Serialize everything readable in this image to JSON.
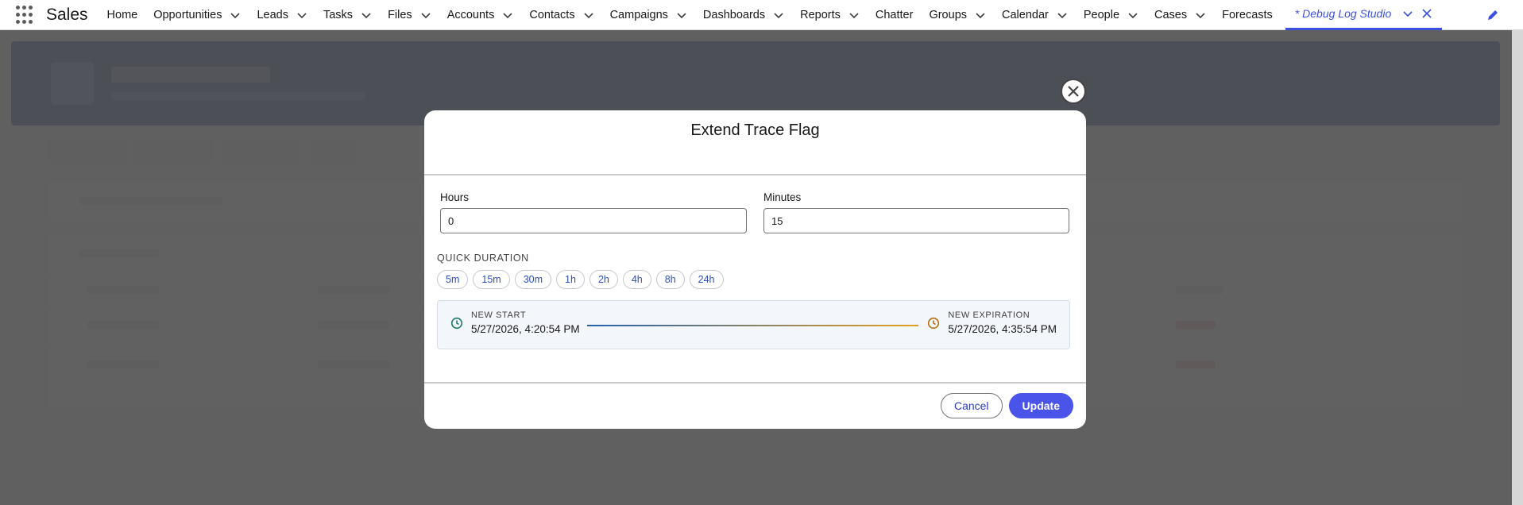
{
  "app": {
    "name": "Sales"
  },
  "nav": {
    "items": [
      {
        "label": "Home",
        "dropdown": false
      },
      {
        "label": "Opportunities",
        "dropdown": true
      },
      {
        "label": "Leads",
        "dropdown": true
      },
      {
        "label": "Tasks",
        "dropdown": true
      },
      {
        "label": "Files",
        "dropdown": true
      },
      {
        "label": "Accounts",
        "dropdown": true
      },
      {
        "label": "Contacts",
        "dropdown": true
      },
      {
        "label": "Campaigns",
        "dropdown": true
      },
      {
        "label": "Dashboards",
        "dropdown": true
      },
      {
        "label": "Reports",
        "dropdown": true
      },
      {
        "label": "Chatter",
        "dropdown": false
      },
      {
        "label": "Groups",
        "dropdown": true
      },
      {
        "label": "Calendar",
        "dropdown": true
      },
      {
        "label": "People",
        "dropdown": true
      },
      {
        "label": "Cases",
        "dropdown": true
      },
      {
        "label": "Forecasts",
        "dropdown": false
      }
    ],
    "active_tab": "* Debug Log Studio"
  },
  "modal": {
    "title": "Extend Trace Flag",
    "hours": {
      "label": "Hours",
      "value": "0"
    },
    "minutes": {
      "label": "Minutes",
      "value": "15"
    },
    "quick_duration": {
      "label": "QUICK DURATION",
      "options": [
        "5m",
        "15m",
        "30m",
        "1h",
        "2h",
        "4h",
        "8h",
        "24h"
      ]
    },
    "timeline": {
      "start_caption": "NEW START",
      "start_value": "5/27/2026, 4:20:54 PM",
      "end_caption": "NEW EXPIRATION",
      "end_value": "5/27/2026, 4:35:54 PM"
    },
    "cancel_label": "Cancel",
    "update_label": "Update"
  },
  "colors": {
    "accent": "#3b50e0",
    "primary_button": "#4a54e8",
    "start_clock": "#1b7a6a",
    "end_clock": "#b5700d",
    "overlay": "#505050"
  }
}
